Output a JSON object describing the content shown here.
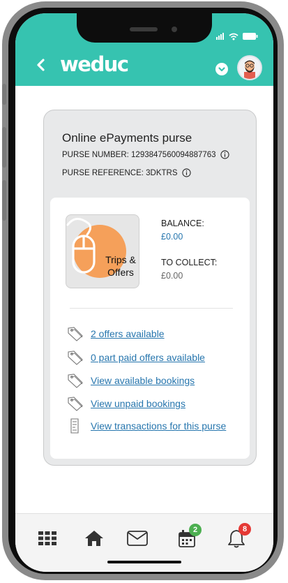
{
  "header": {
    "logo_text": "weduc",
    "brand_color": "#36c3b0"
  },
  "purse": {
    "title": "Online ePayments purse",
    "number_label": "PURSE NUMBER: 1293847560094887763",
    "reference_label": "PURSE REFERENCE: 3DKTRS",
    "tile_line1": "Trips &",
    "tile_line2": "Offers",
    "balance_label": "BALANCE:",
    "balance_value": "£0.00",
    "collect_label": "TO COLLECT:",
    "collect_value": "£0.00"
  },
  "links": [
    {
      "label": "2 offers available",
      "icon": "tag-icon"
    },
    {
      "label": "0 part paid offers available",
      "icon": "tag-icon"
    },
    {
      "label": "View available bookings",
      "icon": "tag-icon"
    },
    {
      "label": "View unpaid bookings",
      "icon": "tag-icon"
    },
    {
      "label": "View transactions for this purse",
      "icon": "receipt-icon"
    }
  ],
  "nav": {
    "items": [
      {
        "name": "apps-grid-icon"
      },
      {
        "name": "home-icon"
      },
      {
        "name": "mail-icon"
      },
      {
        "name": "calendar-icon",
        "badge": "2",
        "badge_color": "#4caf50"
      },
      {
        "name": "bell-icon",
        "badge": "8",
        "badge_color": "#e53935"
      }
    ]
  },
  "colors": {
    "link": "#2776ae",
    "card_bg": "#e8e9ea",
    "tile_accent": "#f5a05a"
  }
}
